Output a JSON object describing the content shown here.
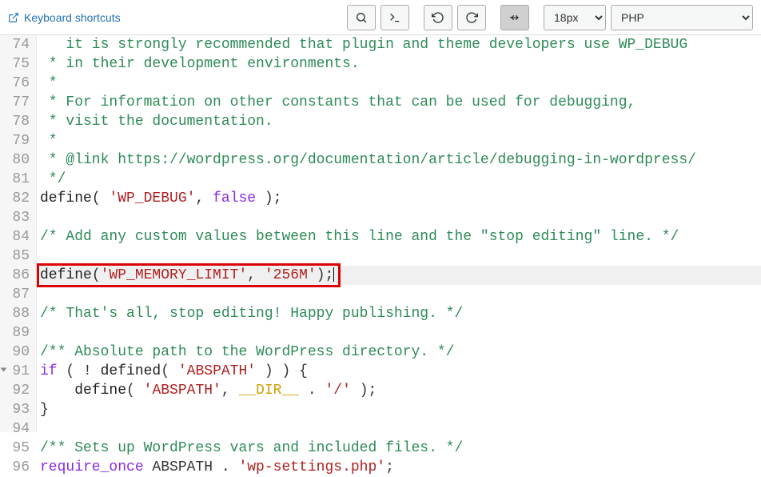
{
  "toolbar": {
    "shortcuts_label": "Keyboard shortcuts",
    "font_size": "18px",
    "language": "PHP"
  },
  "icons": {
    "external": "external-link-icon",
    "search": "search-icon",
    "prompt": "prompt-icon",
    "undo": "undo-icon",
    "redo": "redo-icon",
    "wrap": "wrap-icon"
  },
  "gutter": {
    "start": 74,
    "count": 23,
    "fold_lines": [
      91
    ]
  },
  "code_lines": [
    {
      "n": 74,
      "seg": [
        {
          "t": "   it is strongly recommended that plugin and theme developers use WP_DEBUG",
          "c": "c-comment truncated"
        }
      ]
    },
    {
      "n": 75,
      "seg": [
        {
          "t": " * in their development environments.",
          "c": "c-comment"
        }
      ]
    },
    {
      "n": 76,
      "seg": [
        {
          "t": " *",
          "c": "c-comment"
        }
      ]
    },
    {
      "n": 77,
      "seg": [
        {
          "t": " * For information on other constants that can be used for debugging,",
          "c": "c-comment"
        }
      ]
    },
    {
      "n": 78,
      "seg": [
        {
          "t": " * visit the documentation.",
          "c": "c-comment"
        }
      ]
    },
    {
      "n": 79,
      "seg": [
        {
          "t": " *",
          "c": "c-comment"
        }
      ]
    },
    {
      "n": 80,
      "seg": [
        {
          "t": " * @link https://wordpress.org/documentation/article/debugging-in-wordpress/",
          "c": "c-comment"
        }
      ]
    },
    {
      "n": 81,
      "seg": [
        {
          "t": " */",
          "c": "c-comment"
        }
      ]
    },
    {
      "n": 82,
      "seg": [
        {
          "t": "define",
          "c": "c-func"
        },
        {
          "t": "( ",
          "c": "c-op"
        },
        {
          "t": "'WP_DEBUG'",
          "c": "c-str"
        },
        {
          "t": ", ",
          "c": "c-op"
        },
        {
          "t": "false",
          "c": "c-kw"
        },
        {
          "t": " );",
          "c": "c-op"
        }
      ]
    },
    {
      "n": 83,
      "seg": []
    },
    {
      "n": 84,
      "seg": [
        {
          "t": "/* Add any custom values between this line and the \"stop editing\" line. */",
          "c": "c-comment"
        }
      ]
    },
    {
      "n": 85,
      "seg": []
    },
    {
      "n": 86,
      "hl": true,
      "cursor": true,
      "seg": [
        {
          "t": "define",
          "c": "c-func"
        },
        {
          "t": "(",
          "c": "c-op"
        },
        {
          "t": "'WP_MEMORY_LIMIT'",
          "c": "c-str"
        },
        {
          "t": ", ",
          "c": "c-op"
        },
        {
          "t": "'256M'",
          "c": "c-str"
        },
        {
          "t": ");",
          "c": "c-op"
        }
      ]
    },
    {
      "n": 87,
      "seg": []
    },
    {
      "n": 88,
      "seg": [
        {
          "t": "/* That's all, stop editing! Happy publishing. */",
          "c": "c-comment"
        }
      ]
    },
    {
      "n": 89,
      "seg": []
    },
    {
      "n": 90,
      "seg": [
        {
          "t": "/** Absolute path to the WordPress directory. */",
          "c": "c-comment"
        }
      ]
    },
    {
      "n": 91,
      "seg": [
        {
          "t": "if",
          "c": "c-kw"
        },
        {
          "t": " ( ! ",
          "c": "c-op"
        },
        {
          "t": "defined",
          "c": "c-func"
        },
        {
          "t": "( ",
          "c": "c-op"
        },
        {
          "t": "'ABSPATH'",
          "c": "c-str"
        },
        {
          "t": " ) ) {",
          "c": "c-op"
        }
      ]
    },
    {
      "n": 92,
      "seg": [
        {
          "t": "    ",
          "c": ""
        },
        {
          "t": "define",
          "c": "c-func"
        },
        {
          "t": "( ",
          "c": "c-op"
        },
        {
          "t": "'ABSPATH'",
          "c": "c-str"
        },
        {
          "t": ", ",
          "c": "c-op"
        },
        {
          "t": "__DIR__",
          "c": "c-const"
        },
        {
          "t": " . ",
          "c": "c-op"
        },
        {
          "t": "'/'",
          "c": "c-str"
        },
        {
          "t": " );",
          "c": "c-op"
        }
      ]
    },
    {
      "n": 93,
      "seg": [
        {
          "t": "}",
          "c": "c-op"
        }
      ]
    },
    {
      "n": 94,
      "seg": []
    },
    {
      "n": 95,
      "seg": [
        {
          "t": "/** Sets up WordPress vars and included files. */",
          "c": "c-comment"
        }
      ]
    },
    {
      "n": 96,
      "seg": [
        {
          "t": "require_once",
          "c": "c-kw"
        },
        {
          "t": " ABSPATH . ",
          "c": "c-op"
        },
        {
          "t": "'wp-settings.php'",
          "c": "c-str"
        },
        {
          "t": ";",
          "c": "c-op"
        }
      ]
    }
  ],
  "highlight_line": 86
}
